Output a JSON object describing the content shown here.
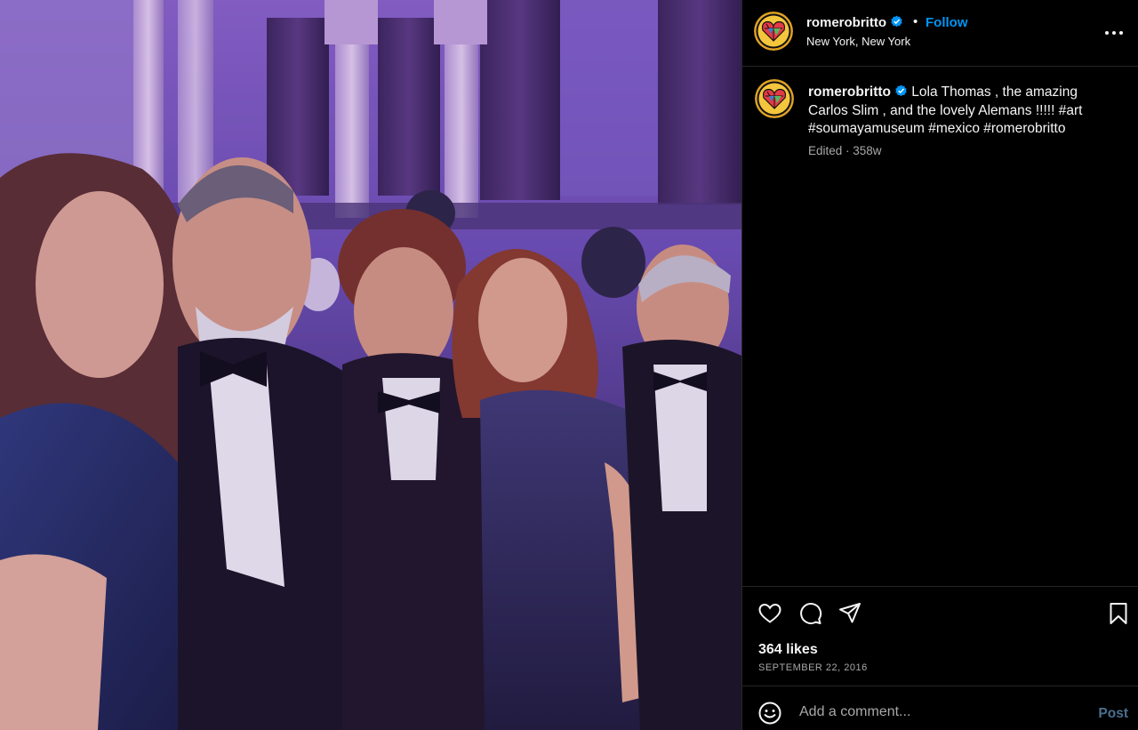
{
  "post": {
    "username": "romerobritto",
    "verified": true,
    "separator": "•",
    "follow_label": "Follow",
    "location": "New York, New York",
    "caption_text": " Lola Thomas , the amazing Carlos Slim , and the lovely Alemans !!!!! #art #soumayamuseum #mexico #romerobritto",
    "meta": "Edited · 358w",
    "likes": "364 likes",
    "date": "SEPTEMBER 22, 2016"
  },
  "comment": {
    "placeholder": "Add a comment...",
    "post_label": "Post"
  },
  "icons": {
    "like": "heart-icon",
    "comment": "comment-bubble-icon",
    "share": "paper-plane-icon",
    "save": "bookmark-icon",
    "emoji": "smiley-icon",
    "more": "three-dots-icon",
    "verified": "verified-badge-icon"
  },
  "colors": {
    "background": "#000000",
    "follow": "#0095f6",
    "post_disabled": "#4a6f8f",
    "divider": "#262626",
    "muted_text": "#a8a8a8",
    "verified": "#0095f6"
  }
}
